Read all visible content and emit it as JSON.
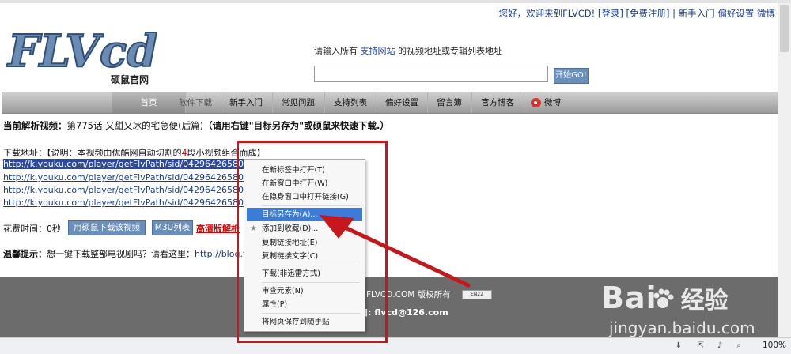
{
  "header": {
    "welcome": "您好，欢迎来到FLVCD!",
    "login": "[登录]",
    "register": "[免费注册]",
    "newbie": "新手入门",
    "prefs": "偏好设置",
    "weibo": "微博"
  },
  "logo": {
    "text": "FLVcd",
    "subtitle": "硕鼠官网"
  },
  "search": {
    "prompt_pre": "请输入所有",
    "prompt_link": "支持网站",
    "prompt_post": "的视频地址或专辑列表地址",
    "value": "",
    "button": "开始GO!"
  },
  "nav": {
    "items": [
      "首页",
      "软件下载",
      "新手入门",
      "常见问题",
      "支持列表",
      "偏好设置",
      "留言簿",
      "官方博客",
      "微博"
    ]
  },
  "current": {
    "label": "当前解析视频：",
    "title": "第775话 又甜又冰的宅急便(后篇)",
    "hint": "（请用右键\"目标另存为\"或硕鼠来快速下载.）"
  },
  "download": {
    "label": "下载地址：【说明：本视频由优酷网自动切割的",
    "count": "4",
    "label_post": "段小视频组合而成】",
    "links": [
      "http://k.youku.com/player/getFlvPath/sid/042964265807912c9b",
      "http://k.youku.com/player/getFlvPath/sid/042964265807912c9b",
      "http://k.youku.com/player/getFlvPath/sid/042964265807912c9b",
      "http://k.youku.com/player/getFlvPath/sid/042964265807912c9b"
    ]
  },
  "cost": {
    "label": "花费时间：0秒",
    "btn_download": "用硕鼠下载该视频",
    "btn_m3u": "M3U列表",
    "hd": "高清版解析"
  },
  "tip": {
    "label": "温馨提示：",
    "text": "想一键下载整部电视剧吗？请看这里：",
    "link": "http://blog.flvcd"
  },
  "footer": {
    "copy": "4 FLVCD.COM 版权所有",
    "flag": "EN22",
    "email": "]: flvcd@126.com"
  },
  "context_menu": {
    "items": [
      "在新标签中打开(T)",
      "在新窗口中打开(W)",
      "在隐身窗口中打开链接(G)",
      "目标另存为(A)...",
      "添加到收藏(D)...",
      "复制链接地址(E)",
      "复制链接文字(C)",
      "下载(非迅雷方式)",
      "审查元素(N)",
      "属性(P)",
      "将网页保存到随手贴"
    ]
  },
  "statusbar": {
    "zoom": "100%"
  },
  "watermark": {
    "brand": "Bai",
    "cn": "经验",
    "url": "jingyan.baidu.com"
  },
  "colors": {
    "annotation": "#c8161d",
    "highlight": "#3d7bd8",
    "nav_bg": "#9a9a9a"
  }
}
